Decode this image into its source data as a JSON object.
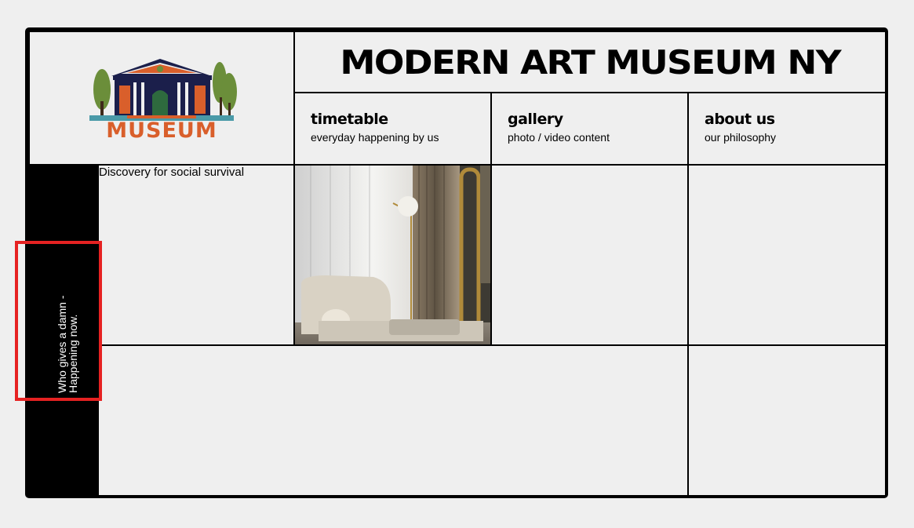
{
  "header": {
    "title": "MODERN ART MUSEUM NY",
    "logo_text": "MUSEUM"
  },
  "nav": [
    {
      "label": "timetable",
      "sub": "everyday happening by us"
    },
    {
      "label": "gallery",
      "sub": "photo / video content"
    },
    {
      "label": "about us",
      "sub": "our philosophy"
    }
  ],
  "content": {
    "intro": "Discovery for social survival",
    "side_text": "Who gives a damn - Happening now."
  },
  "colors": {
    "background": "#efefef",
    "frame": "#000000",
    "highlight": "#e62222",
    "logo_orange": "#d95f2b",
    "logo_navy": "#1b1f4b",
    "logo_green": "#6b8e3a",
    "logo_teal": "#4a9aa8"
  }
}
